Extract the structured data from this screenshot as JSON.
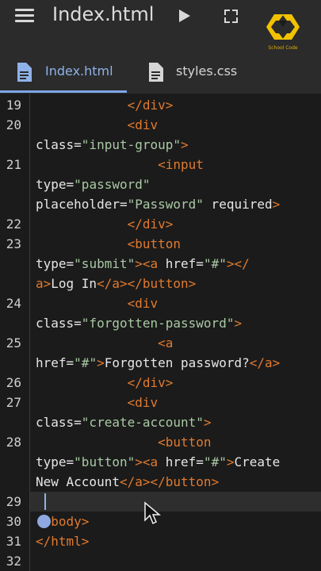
{
  "app": {
    "title": "Index.html",
    "logo_text": "School Code"
  },
  "tabs": [
    {
      "label": "Index.html",
      "active": true
    },
    {
      "label": "styles.css",
      "active": false
    }
  ],
  "colors": {
    "tag": "#e07a2e",
    "string": "#a9c9a4",
    "accent": "#8fb2ea",
    "background": "#1b1b1b",
    "bar": "#2b2b2b"
  },
  "editor": {
    "current_line": 29,
    "lines": [
      {
        "n": "19",
        "p": [
          {
            "c": "tag",
            "t": "            </div>"
          }
        ]
      },
      {
        "n": "20",
        "p": [
          {
            "c": "tag",
            "t": "            <div"
          }
        ]
      },
      {
        "n": "",
        "p": [
          {
            "c": "attr",
            "t": "class="
          },
          {
            "c": "str",
            "t": "\"input-group\""
          },
          {
            "c": "tag",
            "t": ">"
          }
        ]
      },
      {
        "n": "21",
        "p": [
          {
            "c": "tag",
            "t": "                <input"
          }
        ]
      },
      {
        "n": "",
        "p": [
          {
            "c": "attr",
            "t": "type="
          },
          {
            "c": "str",
            "t": "\"password\""
          }
        ]
      },
      {
        "n": "",
        "p": [
          {
            "c": "attr",
            "t": "placeholder="
          },
          {
            "c": "str",
            "t": "\"Password\""
          },
          {
            "c": "attr",
            "t": " required"
          },
          {
            "c": "tag",
            "t": ">"
          }
        ]
      },
      {
        "n": "22",
        "p": [
          {
            "c": "tag",
            "t": "            </div>"
          }
        ]
      },
      {
        "n": "23",
        "p": [
          {
            "c": "tag",
            "t": "            <button"
          }
        ]
      },
      {
        "n": "",
        "p": [
          {
            "c": "attr",
            "t": "type="
          },
          {
            "c": "str",
            "t": "\"submit\""
          },
          {
            "c": "tag",
            "t": "><a "
          },
          {
            "c": "attr",
            "t": "href="
          },
          {
            "c": "str",
            "t": "\"#\""
          },
          {
            "c": "tag",
            "t": "></"
          }
        ]
      },
      {
        "n": "",
        "p": [
          {
            "c": "tag",
            "t": "a>"
          },
          {
            "c": "txt",
            "t": "Log In"
          },
          {
            "c": "tag",
            "t": "</a></button>"
          }
        ]
      },
      {
        "n": "24",
        "p": [
          {
            "c": "tag",
            "t": "            <div"
          }
        ]
      },
      {
        "n": "",
        "p": [
          {
            "c": "attr",
            "t": "class="
          },
          {
            "c": "str",
            "t": "\"forgotten-password\""
          },
          {
            "c": "tag",
            "t": ">"
          }
        ]
      },
      {
        "n": "25",
        "p": [
          {
            "c": "tag",
            "t": "                <a"
          }
        ]
      },
      {
        "n": "",
        "p": [
          {
            "c": "attr",
            "t": "href="
          },
          {
            "c": "str",
            "t": "\"#\""
          },
          {
            "c": "tag",
            "t": ">"
          },
          {
            "c": "txt",
            "t": "Forgotten password?"
          },
          {
            "c": "tag",
            "t": "</a>"
          }
        ]
      },
      {
        "n": "26",
        "p": [
          {
            "c": "tag",
            "t": "            </div>"
          }
        ]
      },
      {
        "n": "27",
        "p": [
          {
            "c": "tag",
            "t": "            <div"
          }
        ]
      },
      {
        "n": "",
        "p": [
          {
            "c": "attr",
            "t": "class="
          },
          {
            "c": "str",
            "t": "\"create-account\""
          },
          {
            "c": "tag",
            "t": ">"
          }
        ]
      },
      {
        "n": "28",
        "p": [
          {
            "c": "tag",
            "t": "                <button"
          }
        ]
      },
      {
        "n": "",
        "p": [
          {
            "c": "attr",
            "t": "type="
          },
          {
            "c": "str",
            "t": "\"button\""
          },
          {
            "c": "tag",
            "t": "><a "
          },
          {
            "c": "attr",
            "t": "href="
          },
          {
            "c": "str",
            "t": "\"#\""
          },
          {
            "c": "tag",
            "t": ">"
          },
          {
            "c": "txt",
            "t": "Create"
          }
        ]
      },
      {
        "n": "",
        "p": [
          {
            "c": "txt",
            "t": "New Account"
          },
          {
            "c": "tag",
            "t": "</a></button>"
          }
        ]
      },
      {
        "n": "29",
        "p": []
      },
      {
        "n": "30",
        "p": [
          {
            "c": "tag",
            "t": "  body>"
          }
        ]
      },
      {
        "n": "31",
        "p": [
          {
            "c": "tag",
            "t": "</html>"
          }
        ]
      },
      {
        "n": "32",
        "p": []
      }
    ]
  }
}
